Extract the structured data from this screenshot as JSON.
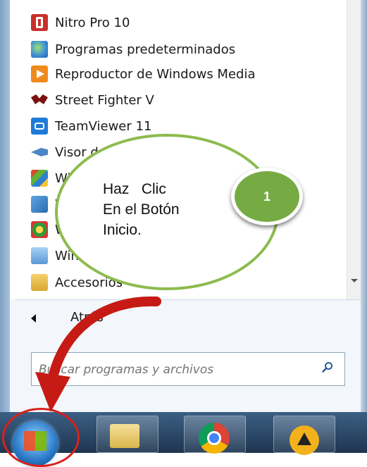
{
  "start_menu": {
    "programs": [
      {
        "label": "Nitro Pro 10",
        "icon": "nitro-icon"
      },
      {
        "label": "Programas predeterminados",
        "icon": "default-programs-icon"
      },
      {
        "label": "Reproductor de Windows Media",
        "icon": "media-player-icon"
      },
      {
        "label": "Street Fighter V",
        "icon": "street-fighter-icon"
      },
      {
        "label": "TeamViewer 11",
        "icon": "teamviewer-icon"
      },
      {
        "label": "Visor de XPS",
        "icon": "xps-viewer-icon"
      },
      {
        "label": "Win",
        "icon": "windows-app-icon"
      },
      {
        "label": "W",
        "icon": "windows-app-icon"
      },
      {
        "label": "W",
        "icon": "windows-app-icon"
      },
      {
        "label": "Win",
        "icon": "windows-app-icon"
      },
      {
        "label": "Accesorios",
        "icon": "folder-icon"
      }
    ],
    "back_label": "Atrás",
    "search_placeholder": "Buscar programas y archivos"
  },
  "callout": {
    "text": "Haz   Clic\nEn el Botón\nInicio.",
    "step_number": "1"
  },
  "taskbar": {
    "items": [
      "start-orb",
      "file-explorer-icon",
      "chrome-icon",
      "aimp-icon"
    ]
  },
  "colors": {
    "callout_border": "#8dbb4e",
    "badge_fill": "#76ab44",
    "highlight": "#d8211c"
  }
}
